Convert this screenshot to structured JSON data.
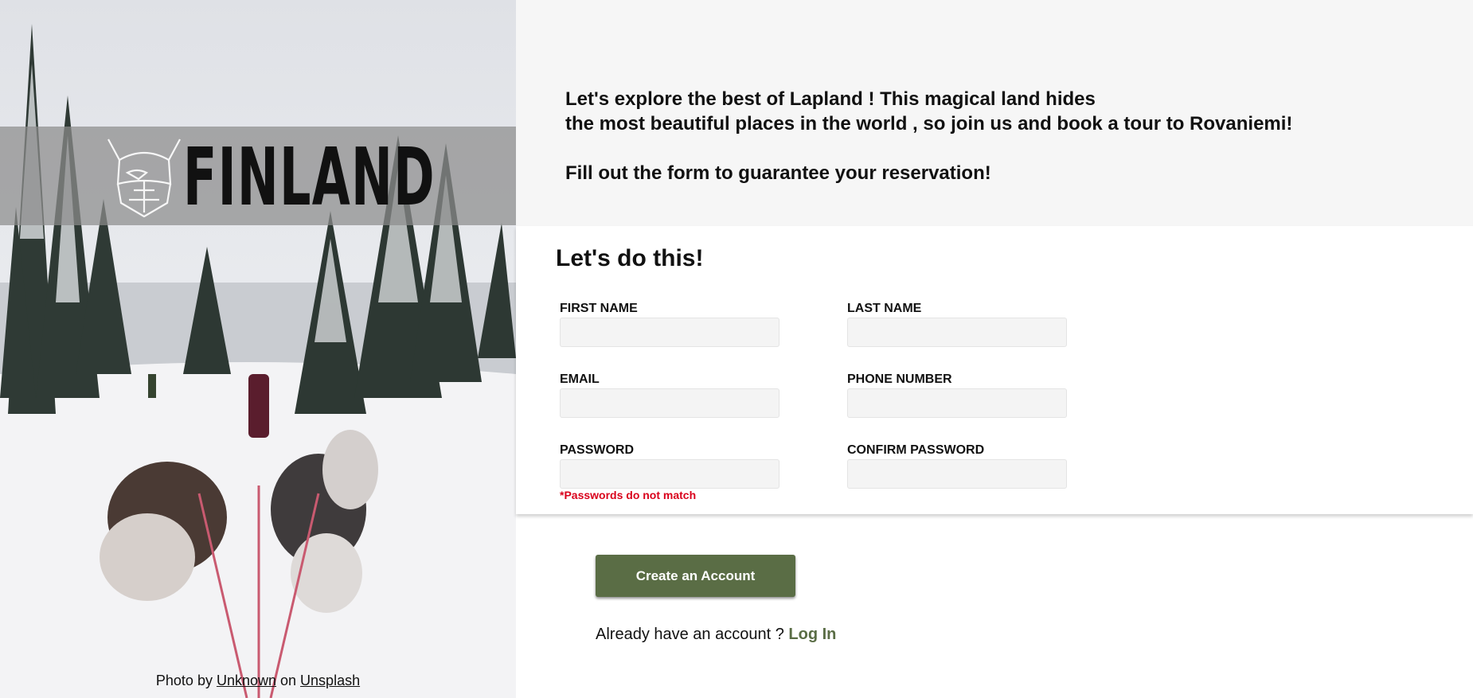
{
  "hero": {
    "logo_text": "FINLAND",
    "credit_prefix": "Photo by ",
    "credit_author": "Unknown",
    "credit_middle": " on ",
    "credit_site": "Unsplash"
  },
  "intro": {
    "line1": "Let's explore the best of Lapland ! This magical land hides",
    "line2": "the most beautiful places in the world , so join us and book a tour to Rovaniemi!",
    "line3": "Fill out the form to guarantee your reservation!"
  },
  "form": {
    "title": "Let's do this!",
    "fields": {
      "first_name": "FIRST NAME",
      "last_name": "LAST NAME",
      "email": "EMAIL",
      "phone": "PHONE NUMBER",
      "password": "PASSWORD",
      "confirm_password": "CONFIRM PASSWORD"
    },
    "error": "*Passwords do not match",
    "submit_label": "Create an Account"
  },
  "login": {
    "prompt": "Already have an account ? ",
    "link": "Log In"
  },
  "colors": {
    "accent": "#5a6d45",
    "error": "#d9001b",
    "intro_bg": "#f6f6f6"
  }
}
